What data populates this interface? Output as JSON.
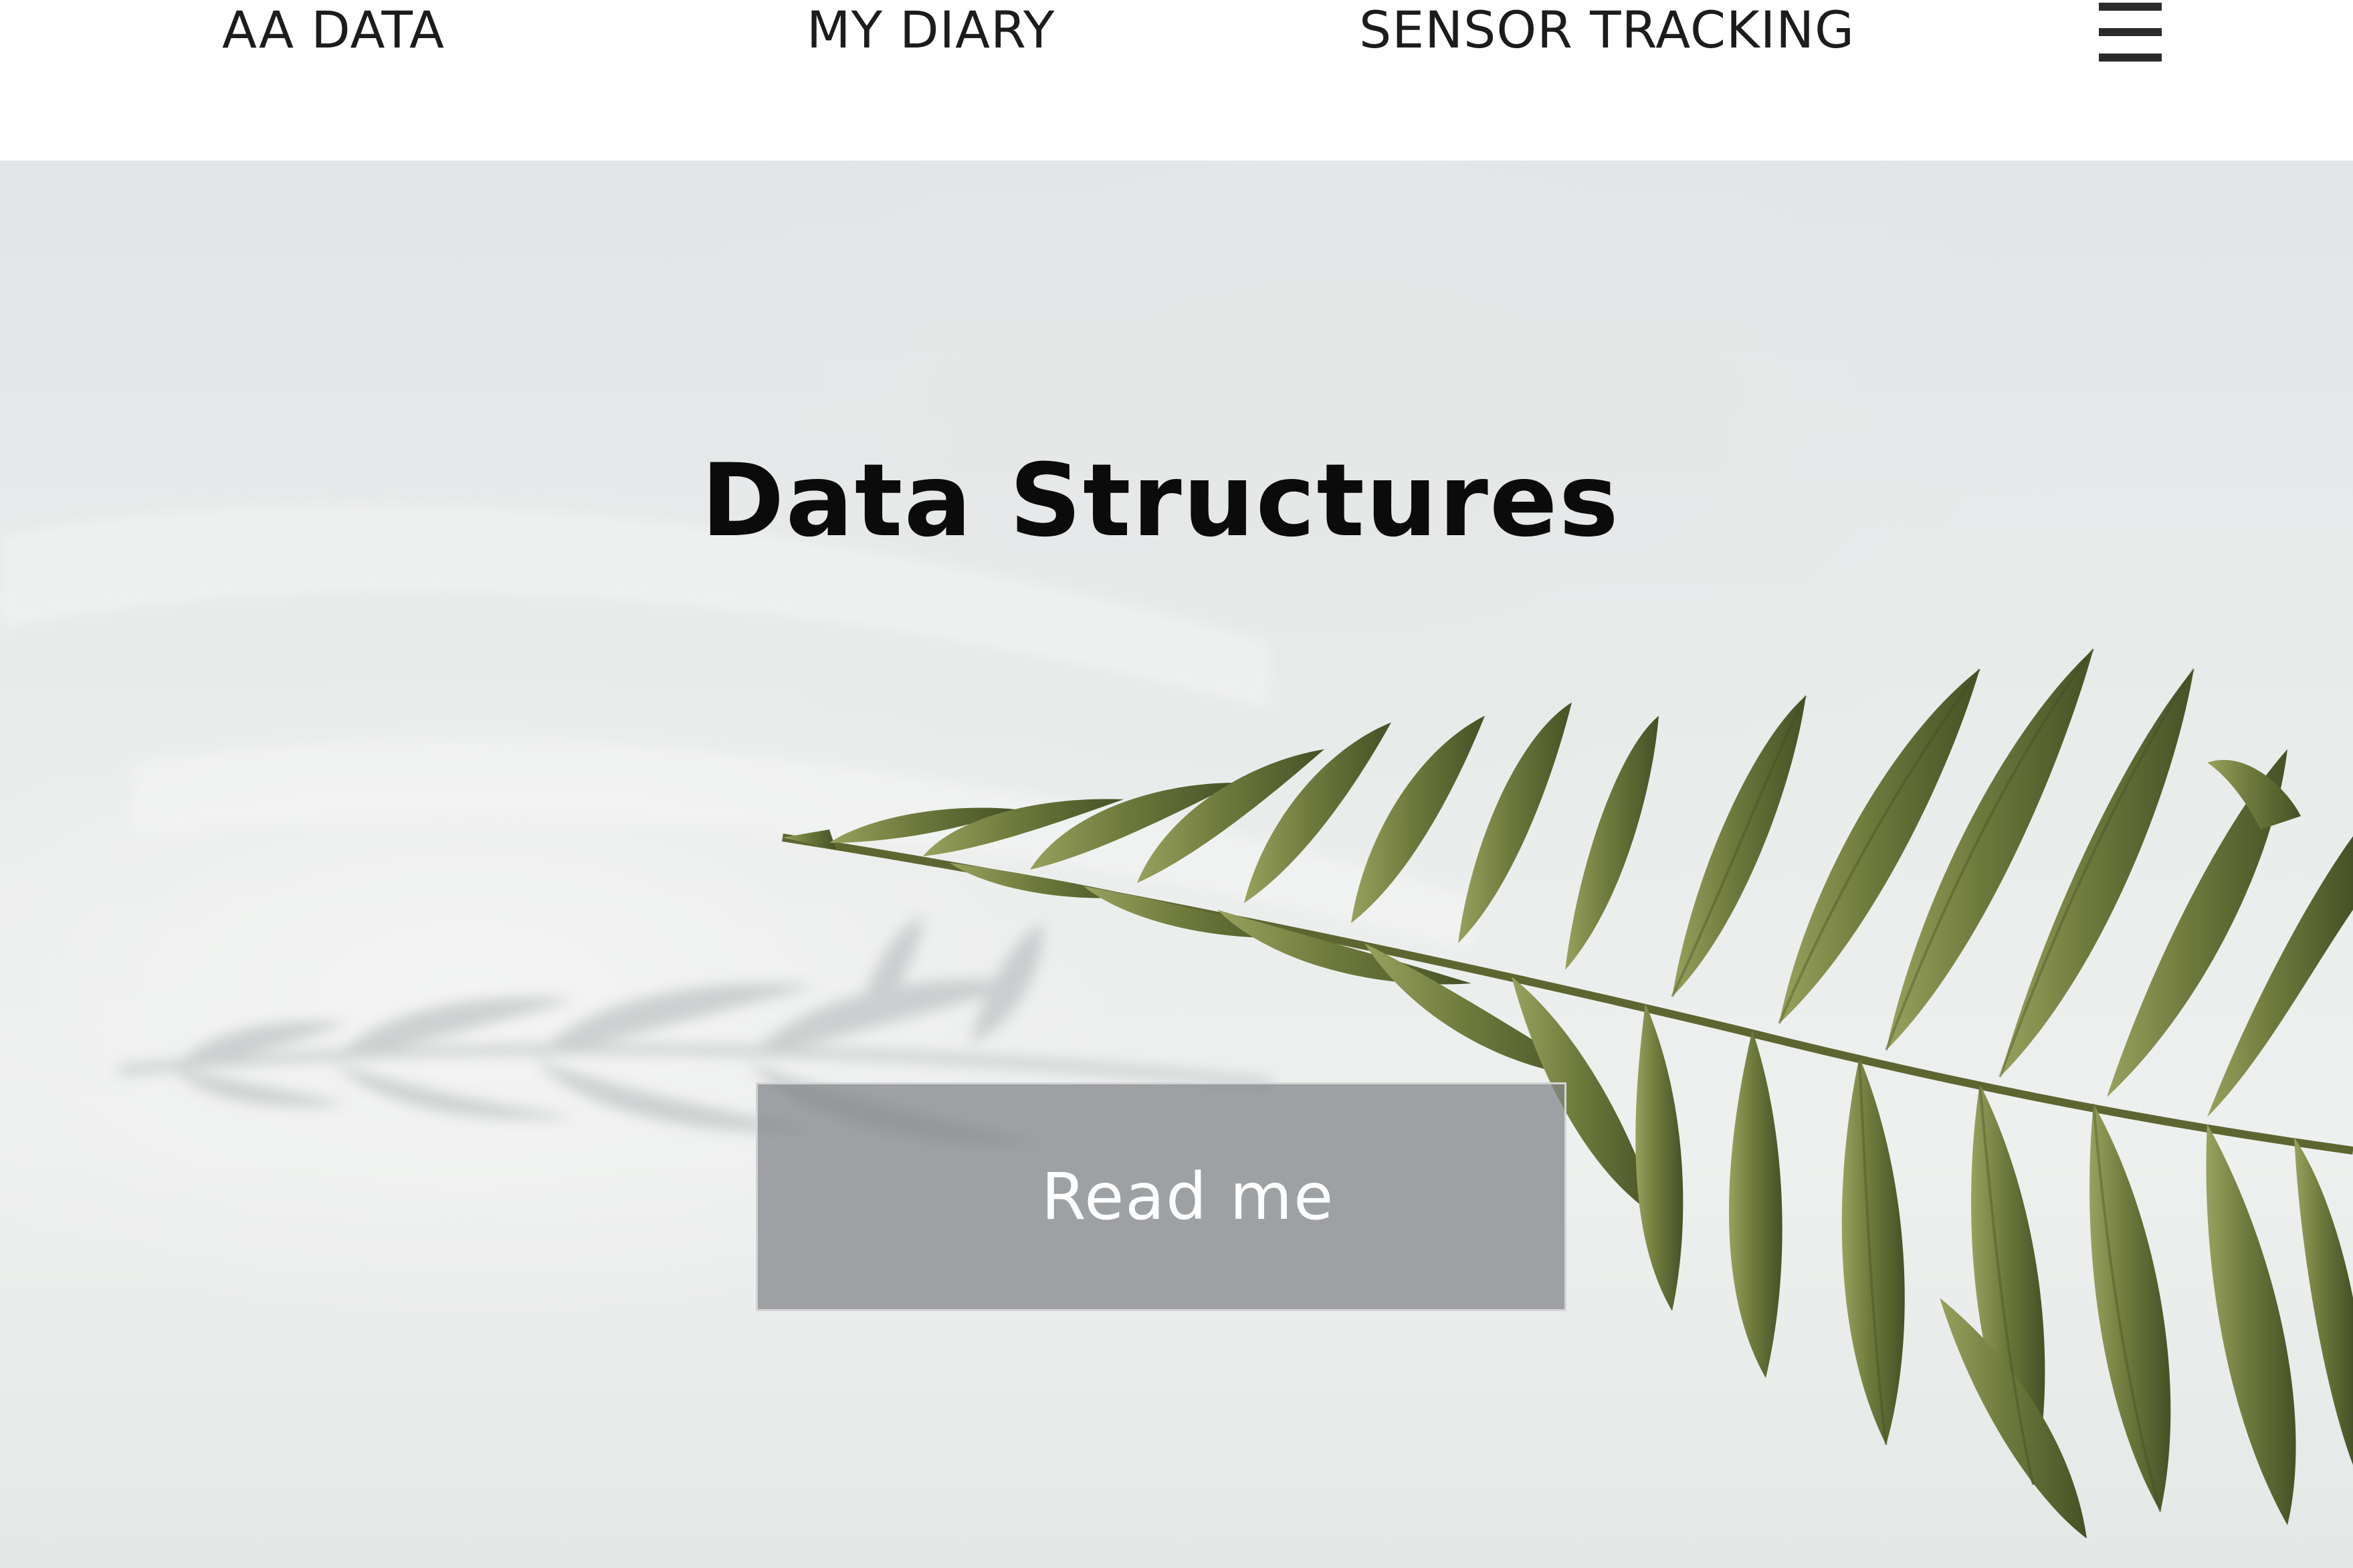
{
  "nav": {
    "links": [
      "AA DATA",
      "MY DIARY",
      "SENSOR TRACKING"
    ],
    "menu_icon": "hamburger-menu-icon"
  },
  "hero": {
    "title": "Data Structures",
    "button_label": "Read me",
    "image": "fern-leaf-photo"
  },
  "colors": {
    "button_bg": "#808286",
    "fern_light": "#8a9655",
    "fern_dark": "#4f5a2c",
    "hero_bg": "#e6e8e8"
  }
}
